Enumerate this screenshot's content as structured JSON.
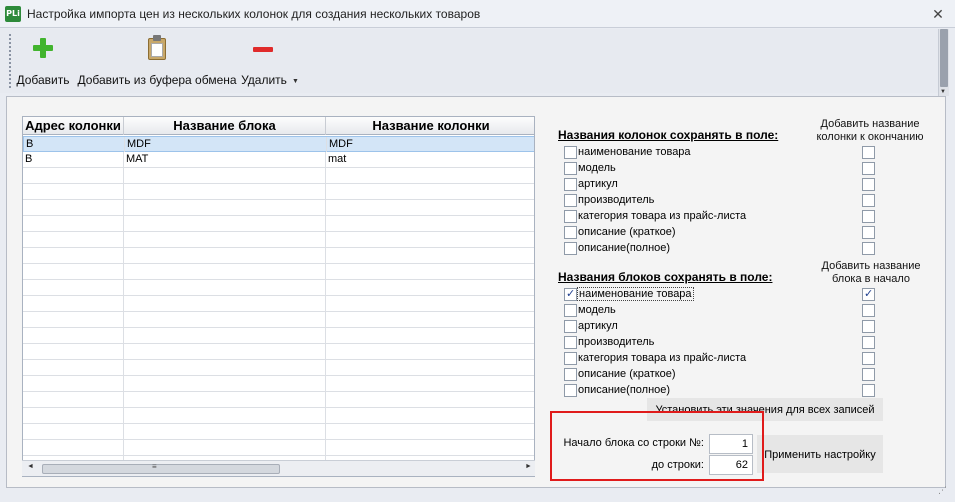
{
  "window": {
    "app_icon_text": "PLi",
    "title": "Настройка импорта цен из нескольких колонок для создания нескольких товаров",
    "close_symbol": "✕"
  },
  "toolbar": {
    "add_label": "Добавить",
    "add_from_clipboard_label": "Добавить из буфера обмена",
    "delete_label": "Удалить",
    "dropdown_symbol": "▼"
  },
  "grid": {
    "columns": [
      "Адрес колонки",
      "Название блока",
      "Название колонки"
    ],
    "rows": [
      {
        "address": "B",
        "block_name": "MDF",
        "column_name": "MDF",
        "selected": true
      },
      {
        "address": "B",
        "block_name": "MAT",
        "column_name": "mat",
        "selected": false
      }
    ],
    "vscroll_up": "▲",
    "vscroll_down": "▼",
    "scroll_grip": "≡",
    "hscroll_left": "◄",
    "hscroll_right": "►"
  },
  "column_names_section": {
    "title": "Названия колонок сохранять в поле:",
    "append_hint": "Добавить название колонки к окончанию",
    "fields": [
      {
        "label": "наименование товара",
        "checked": false,
        "append_checked": false
      },
      {
        "label": "модель",
        "checked": false,
        "append_checked": false
      },
      {
        "label": "артикул",
        "checked": false,
        "append_checked": false
      },
      {
        "label": "производитель",
        "checked": false,
        "append_checked": false
      },
      {
        "label": "категория товара из прайс-листа",
        "checked": false,
        "append_checked": false
      },
      {
        "label": "описание (краткое)",
        "checked": false,
        "append_checked": false
      },
      {
        "label": "описание(полное)",
        "checked": false,
        "append_checked": false
      }
    ]
  },
  "block_names_section": {
    "title": "Названия блоков сохранять в поле:",
    "prepend_hint": "Добавить название блока в начало",
    "fields": [
      {
        "label": "наименование товара",
        "checked": true,
        "prepend_checked": true
      },
      {
        "label": "модель",
        "checked": false,
        "prepend_checked": false
      },
      {
        "label": "артикул",
        "checked": false,
        "prepend_checked": false
      },
      {
        "label": "производитель",
        "checked": false,
        "prepend_checked": false
      },
      {
        "label": "категория товара из прайс-листа",
        "checked": false,
        "prepend_checked": false
      },
      {
        "label": "описание (краткое)",
        "checked": false,
        "prepend_checked": false
      },
      {
        "label": "описание(полное)",
        "checked": false,
        "prepend_checked": false
      }
    ]
  },
  "buttons": {
    "set_all_label": "Установить эти значения для всех записей",
    "apply_label": "Применить настройку"
  },
  "range": {
    "start_label": "Начало блока со строки №:",
    "start_value": "1",
    "end_label": "до строки:",
    "end_value": "62"
  }
}
